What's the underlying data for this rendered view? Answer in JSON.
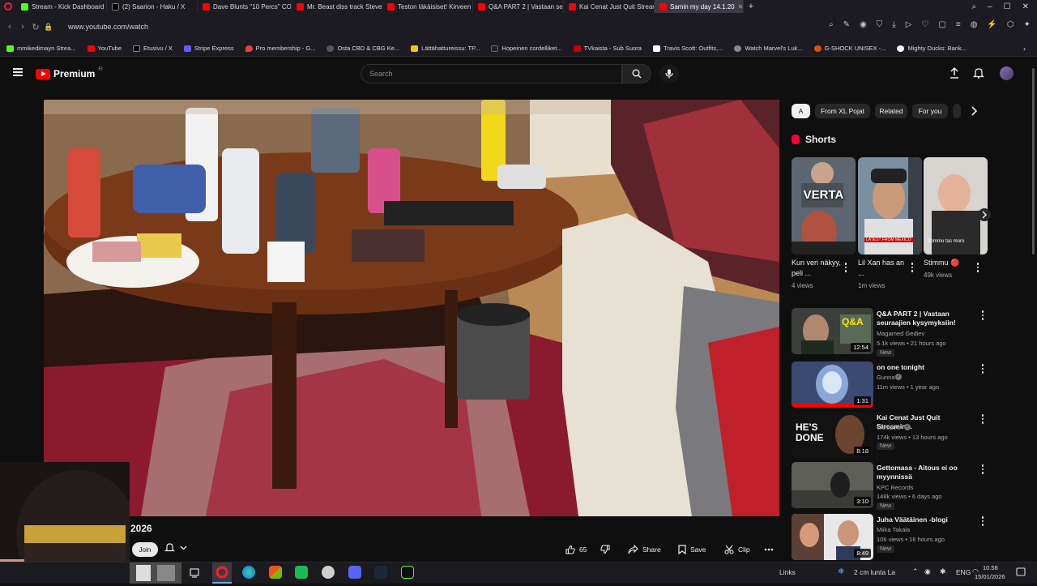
{
  "browser": {
    "tabs": [
      {
        "title": "Stream - Kick Dashboard",
        "color": "#53fc18"
      },
      {
        "title": "(2) Saarion - Haku / X",
        "color": "#000000"
      },
      {
        "title": "Dave Blunts \"10 Percs\" CO",
        "color": "#ff0000"
      },
      {
        "title": "Mr. Beast diss track Steve",
        "color": "#ff0000"
      },
      {
        "title": "Teston läkäisiset! Kirveen",
        "color": "#ff0000"
      },
      {
        "title": "Q&A PART 2 | Vastaan seu",
        "color": "#ff0000"
      },
      {
        "title": "Kai Cenat Just Quit Stream",
        "color": "#ff0000"
      },
      {
        "title": "Samin my day 14.1.20",
        "color": "#ff0000",
        "active": true
      }
    ],
    "url": "www.youtube.com/watch",
    "bookmarks": [
      {
        "label": "mmikedimayn Strea...",
        "color": "#53fc18"
      },
      {
        "label": "YouTube",
        "color": "#ff0000"
      },
      {
        "label": "Etusivu / X",
        "color": "#000000"
      },
      {
        "label": "Stripe Express",
        "color": "#635bff"
      },
      {
        "label": "Pro membership - G...",
        "color": "#ea4335"
      },
      {
        "label": "Osta CBD & CBG Ke...",
        "color": "#555555"
      },
      {
        "label": "Lättähattureissu: TP...",
        "color": "#f5c400"
      },
      {
        "label": "Hopeinen cordelliket...",
        "color": "#222222"
      },
      {
        "label": "TVkaista - Sub Suora",
        "color": "#c80000"
      },
      {
        "label": "Travis Scott: Outfits,...",
        "color": "#ffffff"
      },
      {
        "label": "Watch Marvel's Luk...",
        "color": "#888888"
      },
      {
        "label": "G-SHOCK UNISEX -...",
        "color": "#e35000"
      },
      {
        "label": "Mighty Ducks: Bank...",
        "color": "#ffffff"
      }
    ]
  },
  "youtube": {
    "brand": "Premium",
    "region": "FI",
    "search_placeholder": "Search",
    "video": {
      "title_fragment": "2026",
      "join_label": "Join",
      "likes": "65",
      "share_label": "Share",
      "save_label": "Save",
      "clip_label": "Clip"
    },
    "chips": [
      "A",
      "From XL Pojat",
      "Related",
      "For you"
    ],
    "shorts_label": "Shorts",
    "shorts": [
      {
        "title": "Kun veri näkyy, peli ...",
        "views": "4 views",
        "thumb_text": "VERTA"
      },
      {
        "title": "Lil Xan has an ...",
        "views": "1m views",
        "thumb_text": "LATEST FROM MEXICO"
      },
      {
        "title": "Stimmu 🔴",
        "views": "49k views",
        "thumb_text": "Stimmu tas moro"
      }
    ],
    "recommendations": [
      {
        "title": "Q&A PART 2 | Vastaan seuraajien kysymyksiin!",
        "channel": "Magamed Gediev",
        "meta": "5.1k views • 21 hours ago",
        "badge": "New",
        "duration": "12:54",
        "thumb_text": "Q&A"
      },
      {
        "title": "on one tonight",
        "channel": "Gunna",
        "meta": "11m views • 1 year ago",
        "badge": "",
        "duration": "1:31",
        "thumb_text": ""
      },
      {
        "title": "Kai Cenat Just Quit Streaming.",
        "channel": "WestJett",
        "meta": "174k views • 13 hours ago",
        "badge": "New",
        "duration": "8:18",
        "thumb_text": "HE'S DONE"
      },
      {
        "title": "Gettomasa - Aitous ei oo myynnissä",
        "channel": "KPC Records",
        "meta": "148k views • 6 days ago",
        "badge": "New",
        "duration": "3:10",
        "thumb_text": ""
      },
      {
        "title": "Juha Väätäinen -blogi",
        "channel": "Miika Takala",
        "meta": "106 views • 16 hours ago",
        "badge": "New",
        "duration": "8:49",
        "thumb_text": ""
      }
    ]
  },
  "taskbar": {
    "links_label": "Links",
    "weather": "2 cm lunta La",
    "language": "ENG",
    "time": "10.58",
    "date": "15/01/2026"
  },
  "colors": {
    "youtube_red": "#ff0000",
    "background": "#0f0f0f"
  }
}
